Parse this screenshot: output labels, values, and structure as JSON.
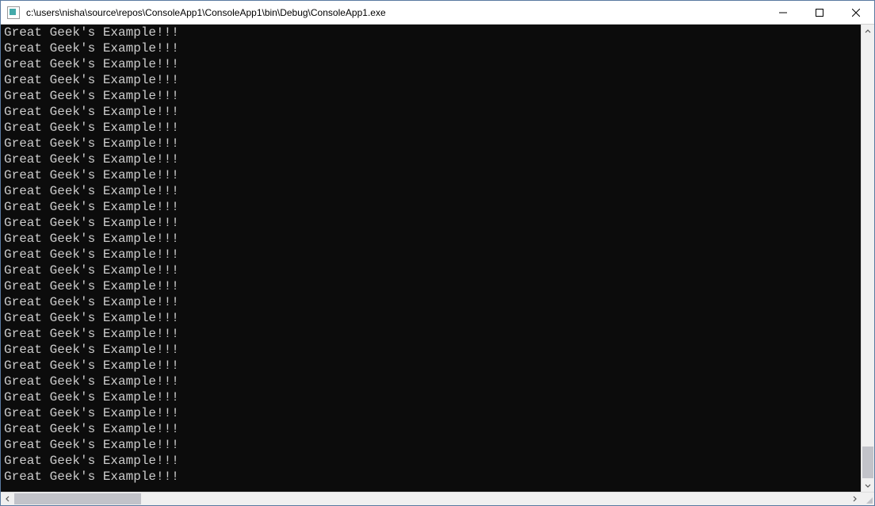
{
  "window": {
    "title": "c:\\users\\nisha\\source\\repos\\ConsoleApp1\\ConsoleApp1\\bin\\Debug\\ConsoleApp1.exe"
  },
  "console": {
    "repeated_line": "Great Geek's Example!!!",
    "visible_line_count": 29,
    "lines": [
      "Great Geek's Example!!!",
      "Great Geek's Example!!!",
      "Great Geek's Example!!!",
      "Great Geek's Example!!!",
      "Great Geek's Example!!!",
      "Great Geek's Example!!!",
      "Great Geek's Example!!!",
      "Great Geek's Example!!!",
      "Great Geek's Example!!!",
      "Great Geek's Example!!!",
      "Great Geek's Example!!!",
      "Great Geek's Example!!!",
      "Great Geek's Example!!!",
      "Great Geek's Example!!!",
      "Great Geek's Example!!!",
      "Great Geek's Example!!!",
      "Great Geek's Example!!!",
      "Great Geek's Example!!!",
      "Great Geek's Example!!!",
      "Great Geek's Example!!!",
      "Great Geek's Example!!!",
      "Great Geek's Example!!!",
      "Great Geek's Example!!!",
      "Great Geek's Example!!!",
      "Great Geek's Example!!!",
      "Great Geek's Example!!!",
      "Great Geek's Example!!!",
      "Great Geek's Example!!!",
      "Great Geek's Example!!!"
    ]
  },
  "colors": {
    "console_bg": "#0c0c0c",
    "console_fg": "#cccccc",
    "window_border": "#5a7aa0"
  }
}
